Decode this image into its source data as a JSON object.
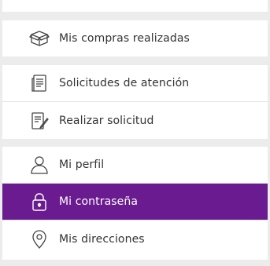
{
  "menu": {
    "groups": [
      {
        "items": [
          {
            "label": "Mis compras realizadas",
            "icon": "box-icon"
          }
        ]
      },
      {
        "items": [
          {
            "label": "Solicitudes de atención",
            "icon": "document-list-icon"
          },
          {
            "label": "Realizar solicitud",
            "icon": "document-edit-icon"
          }
        ]
      },
      {
        "items": [
          {
            "label": "Mi perfil",
            "icon": "user-icon"
          },
          {
            "label": "Mi contraseña",
            "icon": "lock-icon",
            "active": true
          },
          {
            "label": "Mis direcciones",
            "icon": "location-pin-icon"
          }
        ]
      }
    ]
  },
  "colors": {
    "active_background": "#6a1b8f",
    "text": "#333333",
    "page_background": "#ececec"
  }
}
